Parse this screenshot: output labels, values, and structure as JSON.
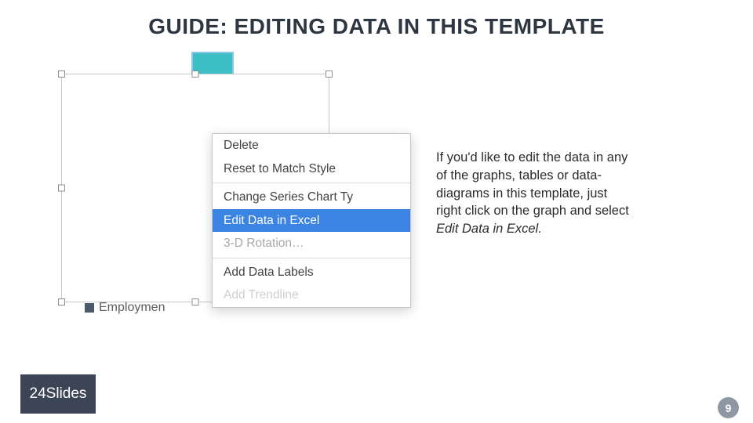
{
  "title": "GUIDE: EDITING DATA IN THIS TEMPLATE",
  "legend_label": "Employmen",
  "context_menu": {
    "delete": "Delete",
    "reset": "Reset to Match Style",
    "change_series": "Change Series Chart Ty",
    "edit_data": "Edit Data in Excel",
    "rotation": "3-D Rotation…",
    "add_labels": "Add Data Labels",
    "add_trendline": "Add Trendline"
  },
  "body": {
    "line1": "If you'd like to edit the data in any",
    "line2": "of the graphs, tables or data-",
    "line3": "diagrams in this template, just",
    "line4": "right click on the graph and select",
    "line5_italic": "Edit Data in Excel."
  },
  "logo_text": "24Slides",
  "page_number": "9"
}
